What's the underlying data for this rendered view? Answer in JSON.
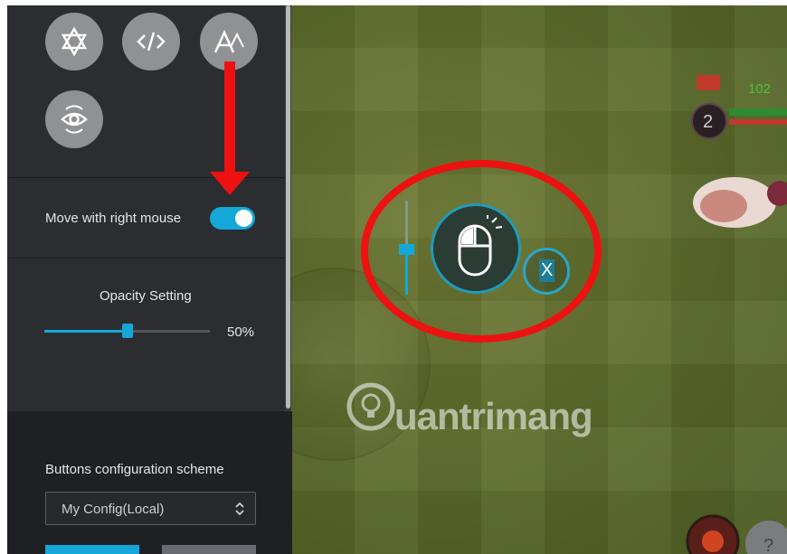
{
  "panel": {
    "toolbar_icons": [
      "star-of-david-icon",
      "code-brackets-icon",
      "font-size-icon",
      "eye-rotate-icon"
    ],
    "move_with_right_mouse": {
      "label": "Move with right mouse",
      "enabled": true
    },
    "opacity": {
      "title": "Opacity Setting",
      "value_label": "50%",
      "value": 0.5
    },
    "buttons_config": {
      "title": "Buttons configuration scheme",
      "selected": "My Config(Local)"
    }
  },
  "game": {
    "watermark": "uantrimang",
    "widget": {
      "close_label": "X",
      "icon": "mouse-icon"
    },
    "hud": {
      "level": "2",
      "hp": "102"
    }
  },
  "colors": {
    "accent": "#13a8d8",
    "panel_bg": "#2b2d31",
    "highlight_red": "#ee1111"
  }
}
